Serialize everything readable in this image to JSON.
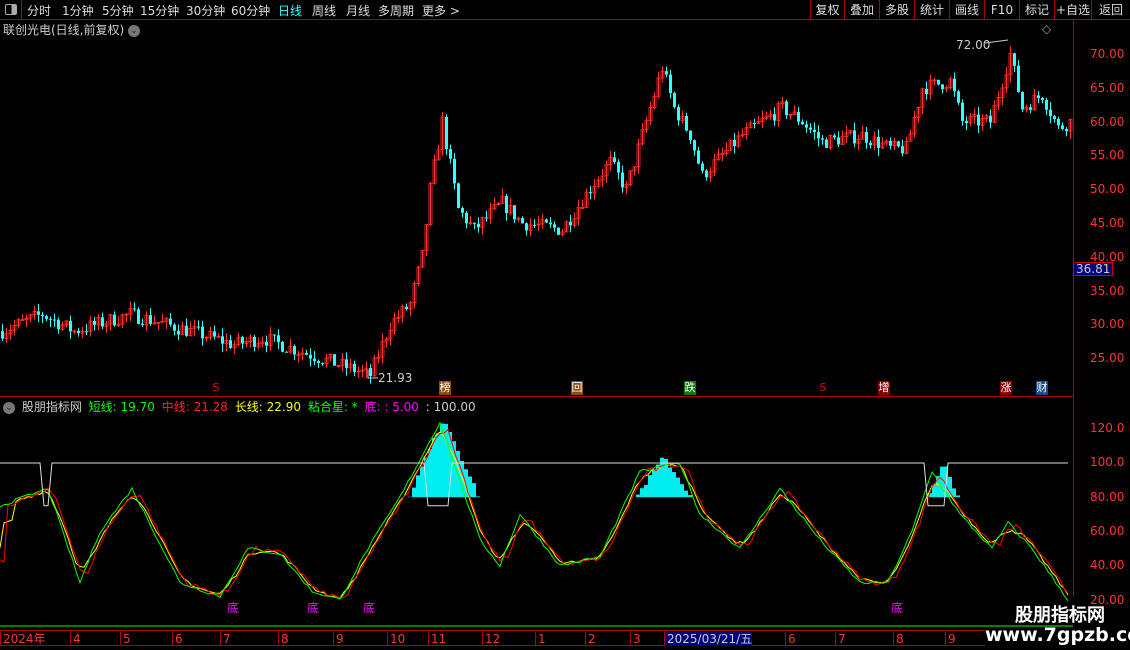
{
  "toolbar": {
    "periods": [
      "分时",
      "1分钟",
      "5分钟",
      "15分钟",
      "30分钟",
      "60分钟",
      "日线",
      "周线",
      "月线",
      "多周期",
      "更多 >"
    ],
    "active": "日线",
    "right_buttons": [
      "复权",
      "叠加",
      "多股",
      "统计",
      "画线",
      "F10",
      "标记",
      "+自选",
      "返回"
    ]
  },
  "stock": {
    "title": "联创光电(日线,前复权)",
    "current_price": "36.81",
    "high_label": "72.00",
    "low_label": "21.93"
  },
  "price_axis": [
    "70.00",
    "65.00",
    "60.00",
    "55.00",
    "50.00",
    "45.00",
    "40.00",
    "35.00",
    "30.00",
    "25.00"
  ],
  "markers": [
    {
      "text": "S",
      "color": "#e00"
    },
    {
      "text": "榜",
      "color": "#8a4a10"
    },
    {
      "text": "回",
      "color": "#8a4a10"
    },
    {
      "text": "跌",
      "color": "#0a7a0a"
    },
    {
      "text": "S",
      "color": "#e00"
    },
    {
      "text": "增",
      "color": "#8a0000"
    },
    {
      "text": "涨",
      "color": "#8a0000"
    },
    {
      "text": "财",
      "color": "#1a4a8a"
    }
  ],
  "indicator": {
    "name": "股朋指标网",
    "short": "短线: 19.70",
    "mid": "中线: 21.28",
    "long": "长线: 22.90",
    "star": "粘合星: *",
    "bottom": "底: : 5.00",
    "top": ": 100.00",
    "axis": [
      "120.0",
      "100.0",
      "80.00",
      "60.00",
      "40.00",
      "20.00"
    ],
    "bottom_label": "底"
  },
  "date_axis": [
    "2024年",
    "4",
    "5",
    "6",
    "7",
    "8",
    "9",
    "10",
    "11",
    "12",
    "1",
    "2",
    "3",
    "2025/03/21/五",
    "6",
    "7",
    "8",
    "9"
  ],
  "watermark": {
    "line1": "股朋指标网",
    "line2": "www.7gpzb.com"
  },
  "colors": {
    "up": "#f33",
    "down": "#3ff",
    "short": "#0f0",
    "mid": "#f00",
    "long": "#ff0",
    "hist": "#0ee"
  },
  "price_path": [
    [
      0,
      29
    ],
    [
      10,
      31.5
    ],
    [
      18,
      29
    ],
    [
      32,
      31.5
    ],
    [
      50,
      28.5
    ],
    [
      58,
      27
    ],
    [
      65,
      28
    ],
    [
      82,
      24.5
    ],
    [
      92,
      22.5
    ],
    [
      97,
      30
    ],
    [
      102,
      33
    ],
    [
      105,
      40
    ],
    [
      107,
      50
    ],
    [
      110,
      60
    ],
    [
      114,
      47
    ],
    [
      118,
      44
    ],
    [
      125,
      48
    ],
    [
      130,
      45
    ],
    [
      140,
      44
    ],
    [
      148,
      51
    ],
    [
      152,
      54
    ],
    [
      156,
      50
    ],
    [
      160,
      58
    ],
    [
      165,
      68
    ],
    [
      168,
      62
    ],
    [
      172,
      58
    ],
    [
      175,
      52
    ],
    [
      180,
      55
    ],
    [
      185,
      58
    ],
    [
      195,
      62
    ],
    [
      200,
      60
    ],
    [
      205,
      57
    ],
    [
      215,
      58
    ],
    [
      222,
      56
    ],
    [
      226,
      56
    ],
    [
      230,
      65
    ],
    [
      237,
      66
    ],
    [
      240,
      60
    ],
    [
      247,
      60
    ],
    [
      252,
      70
    ],
    [
      255,
      62
    ],
    [
      260,
      64
    ],
    [
      264,
      59
    ],
    [
      267,
      60
    ]
  ],
  "short_path": [
    [
      0,
      75
    ],
    [
      12,
      85
    ],
    [
      20,
      30
    ],
    [
      25,
      60
    ],
    [
      33,
      85
    ],
    [
      45,
      30
    ],
    [
      55,
      22
    ],
    [
      62,
      50
    ],
    [
      70,
      47
    ],
    [
      78,
      25
    ],
    [
      85,
      20
    ],
    [
      92,
      50
    ],
    [
      100,
      80
    ],
    [
      110,
      124
    ],
    [
      120,
      55
    ],
    [
      125,
      40
    ],
    [
      130,
      70
    ],
    [
      140,
      40
    ],
    [
      150,
      45
    ],
    [
      155,
      70
    ],
    [
      160,
      95
    ],
    [
      170,
      100
    ],
    [
      175,
      70
    ],
    [
      185,
      50
    ],
    [
      195,
      85
    ],
    [
      205,
      55
    ],
    [
      215,
      30
    ],
    [
      222,
      30
    ],
    [
      228,
      60
    ],
    [
      233,
      95
    ],
    [
      240,
      70
    ],
    [
      248,
      50
    ],
    [
      252,
      65
    ],
    [
      258,
      50
    ],
    [
      267,
      20
    ]
  ],
  "bottom_marks": [
    58,
    78,
    92,
    224
  ]
}
